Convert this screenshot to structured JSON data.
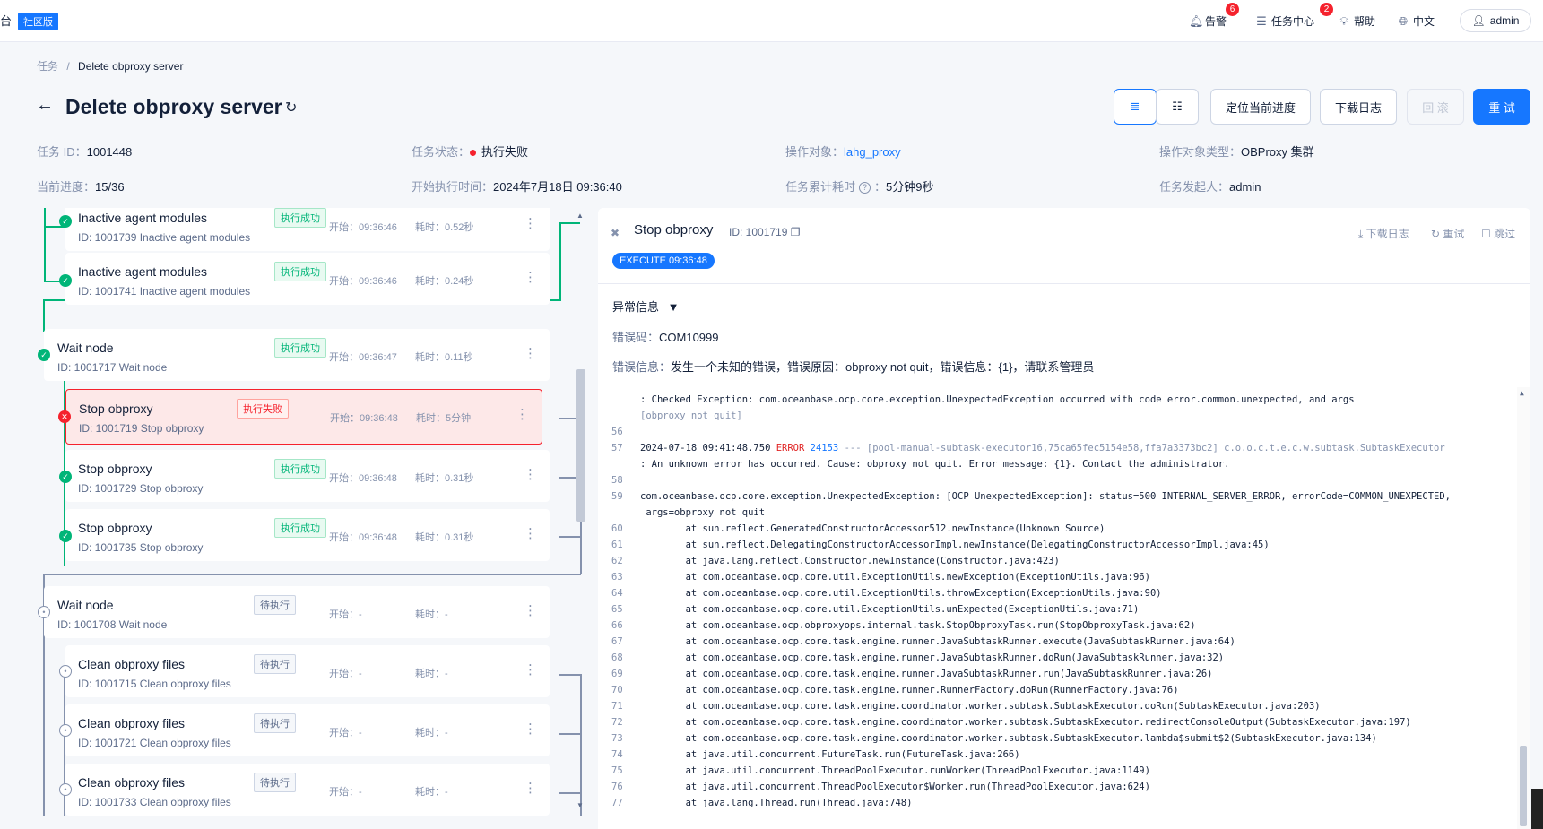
{
  "topbar": {
    "brand_fragment": "台",
    "edition": "社区版",
    "alarm_label": "告警",
    "alarm_count": "6",
    "task_center_label": "任务中心",
    "task_center_count": "2",
    "help_label": "帮助",
    "lang_label": "中文",
    "user_label": "admin"
  },
  "breadcrumb": {
    "root": "任务",
    "sep": "/",
    "current": "Delete obproxy server"
  },
  "header": {
    "title": "Delete obproxy server",
    "locate_label": "定位当前进度",
    "download_label": "下载日志",
    "rollback_label": "回 滚",
    "retry_label": "重 试"
  },
  "meta": {
    "task_id_label": "任务 ID：",
    "task_id": "1001448",
    "status_label": "任务状态：",
    "status": "执行失败",
    "target_label": "操作对象：",
    "target": "lahg_proxy",
    "target_type_label": "操作对象类型：",
    "target_type": "OBProxy 集群",
    "progress_label": "当前进度：",
    "progress": "15/36",
    "start_label": "开始执行时间：",
    "start": "2024年7月18日 09:36:40",
    "elapsed_label": "任务累计耗时",
    "elapsed": "5分钟9秒",
    "initiator_label": "任务发起人：",
    "initiator": "admin"
  },
  "tree": {
    "nodes": [
      {
        "name": "Inactive agent modules",
        "id": "ID: 1001739  Inactive agent modules",
        "tag": "执行成功",
        "start": "开始：09:36:46",
        "dur": "耗时：0.52秒"
      },
      {
        "name": "Inactive agent modules",
        "id": "ID: 1001741  Inactive agent modules",
        "tag": "执行成功",
        "start": "开始：09:36:46",
        "dur": "耗时：0.24秒"
      },
      {
        "name": "Wait node",
        "id": "ID: 1001717  Wait node",
        "tag": "执行成功",
        "start": "开始：09:36:47",
        "dur": "耗时：0.11秒"
      },
      {
        "name": "Stop obproxy",
        "id": "ID: 1001719  Stop obproxy",
        "tag": "执行失败",
        "start": "开始：09:36:48",
        "dur": "耗时：5分钟"
      },
      {
        "name": "Stop obproxy",
        "id": "ID: 1001729  Stop obproxy",
        "tag": "执行成功",
        "start": "开始：09:36:48",
        "dur": "耗时：0.31秒"
      },
      {
        "name": "Stop obproxy",
        "id": "ID: 1001735  Stop obproxy",
        "tag": "执行成功",
        "start": "开始：09:36:48",
        "dur": "耗时：0.31秒"
      },
      {
        "name": "Wait node",
        "id": "ID: 1001708  Wait node",
        "tag": "待执行",
        "start": "开始：-",
        "dur": "耗时：-"
      },
      {
        "name": "Clean obproxy files",
        "id": "ID: 1001715  Clean obproxy files",
        "tag": "待执行",
        "start": "开始：-",
        "dur": "耗时：-"
      },
      {
        "name": "Clean obproxy files",
        "id": "ID: 1001721  Clean obproxy files",
        "tag": "待执行",
        "start": "开始：-",
        "dur": "耗时：-"
      },
      {
        "name": "Clean obproxy files",
        "id": "ID: 1001733  Clean obproxy files",
        "tag": "待执行",
        "start": "开始：-",
        "dur": "耗时：-"
      }
    ]
  },
  "panel": {
    "title": "Stop obproxy",
    "id": "ID: 1001719",
    "download": "下载日志",
    "retry": "重试",
    "skip": "跳过",
    "exec_badge": "EXECUTE 09:36:48",
    "exception_title": "异常信息",
    "err_code_label": "错误码：",
    "err_code": "COM10999",
    "err_info_label": "错误信息：",
    "err_info": "发生一个未知的错误，错误原因：obproxy not quit，错误信息：{1}，请联系管理员"
  },
  "log": {
    "lines": [
      {
        "n": "",
        "t": ": Checked Exception: com.oceanbase.ocp.core.exception.UnexpectedException occurred with code error.common.unexpected, and args"
      },
      {
        "n": "",
        "t": "[obproxy not quit]",
        "c": "g"
      },
      {
        "n": "56",
        "t": ""
      },
      {
        "n": "57",
        "t": "2024-07-18 09:41:48.750 ",
        "err": "ERROR",
        "pid": " 24153",
        "rest": " --- [pool-manual-subtask-executor16,75ca65fec5154e58,ffa7a3373bc2] c.o.o.c.t.e.c.w.subtask.SubtaskExecutor"
      },
      {
        "n": "",
        "t": ": An unknown error has occurred. Cause: obproxy not quit. Error message: {1}. Contact the administrator."
      },
      {
        "n": "58",
        "t": ""
      },
      {
        "n": "59",
        "t": "com.oceanbase.ocp.core.exception.UnexpectedException: [OCP UnexpectedException]: status=500 INTERNAL_SERVER_ERROR, errorCode=COMMON_UNEXPECTED,"
      },
      {
        "n": "",
        "t": " args=obproxy not quit"
      },
      {
        "n": "60",
        "t": "        at sun.reflect.GeneratedConstructorAccessor512.newInstance(Unknown Source)"
      },
      {
        "n": "61",
        "t": "        at sun.reflect.DelegatingConstructorAccessorImpl.newInstance(DelegatingConstructorAccessorImpl.java:45)"
      },
      {
        "n": "62",
        "t": "        at java.lang.reflect.Constructor.newInstance(Constructor.java:423)"
      },
      {
        "n": "63",
        "t": "        at com.oceanbase.ocp.core.util.ExceptionUtils.newException(ExceptionUtils.java:96)"
      },
      {
        "n": "64",
        "t": "        at com.oceanbase.ocp.core.util.ExceptionUtils.throwException(ExceptionUtils.java:90)"
      },
      {
        "n": "65",
        "t": "        at com.oceanbase.ocp.core.util.ExceptionUtils.unExpected(ExceptionUtils.java:71)"
      },
      {
        "n": "66",
        "t": "        at com.oceanbase.ocp.obproxyops.internal.task.StopObproxyTask.run(StopObproxyTask.java:62)"
      },
      {
        "n": "67",
        "t": "        at com.oceanbase.ocp.core.task.engine.runner.JavaSubtaskRunner.execute(JavaSubtaskRunner.java:64)"
      },
      {
        "n": "68",
        "t": "        at com.oceanbase.ocp.core.task.engine.runner.JavaSubtaskRunner.doRun(JavaSubtaskRunner.java:32)"
      },
      {
        "n": "69",
        "t": "        at com.oceanbase.ocp.core.task.engine.runner.JavaSubtaskRunner.run(JavaSubtaskRunner.java:26)"
      },
      {
        "n": "70",
        "t": "        at com.oceanbase.ocp.core.task.engine.runner.RunnerFactory.doRun(RunnerFactory.java:76)"
      },
      {
        "n": "71",
        "t": "        at com.oceanbase.ocp.core.task.engine.coordinator.worker.subtask.SubtaskExecutor.doRun(SubtaskExecutor.java:203)"
      },
      {
        "n": "72",
        "t": "        at com.oceanbase.ocp.core.task.engine.coordinator.worker.subtask.SubtaskExecutor.redirectConsoleOutput(SubtaskExecutor.java:197)"
      },
      {
        "n": "73",
        "t": "        at com.oceanbase.ocp.core.task.engine.coordinator.worker.subtask.SubtaskExecutor.lambda$submit$2(SubtaskExecutor.java:134)"
      },
      {
        "n": "74",
        "t": "        at java.util.concurrent.FutureTask.run(FutureTask.java:266)"
      },
      {
        "n": "75",
        "t": "        at java.util.concurrent.ThreadPoolExecutor.runWorker(ThreadPoolExecutor.java:1149)"
      },
      {
        "n": "76",
        "t": "        at java.util.concurrent.ThreadPoolExecutor$Worker.run(ThreadPoolExecutor.java:624)"
      },
      {
        "n": "77",
        "t": "        at java.lang.Thread.run(Thread.java:748)"
      }
    ]
  }
}
